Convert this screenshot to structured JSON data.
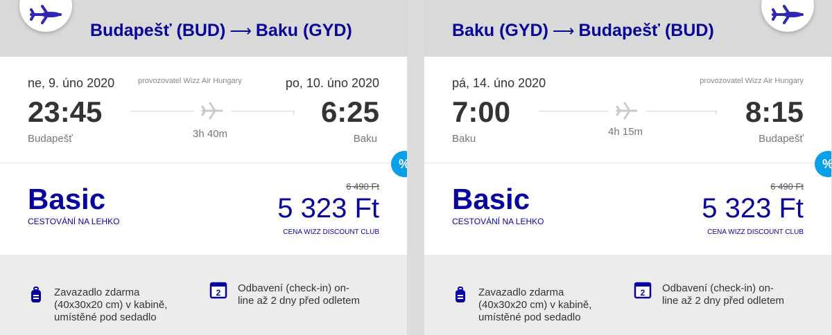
{
  "cards": [
    {
      "from": "Budapešť (BUD)",
      "arrow": "⟶",
      "to": "Baku  (GYD)",
      "dep_date": "ne, 9. úno 2020",
      "operator": "provozovatel Wizz Air Hungary",
      "arr_date": "po, 10. úno 2020",
      "dep_time": "23:45",
      "arr_time": "6:25",
      "duration": "3h 40m",
      "dep_city": "Budapešť",
      "arr_city": "Baku",
      "fare_name": "Basic",
      "fare_sub": "CESTOVÁNÍ NA LEHKO",
      "old_price": "6 490 Ft",
      "new_price": "5 323 Ft",
      "club_label": "CENA WIZZ DISCOUNT CLUB",
      "discount_badge": "%",
      "benefit_bag": "Zavazadlo zdarma\n(40x30x20 cm) v kabině,\numístěné pod sedadlo",
      "benefit_checkin": "Odbavení (check-in) on-\nline až 2 dny před odletem",
      "checkin_icon_num": "2"
    },
    {
      "from": "Baku  (GYD)",
      "arrow": "⟶",
      "to": "Budapešť (BUD)",
      "dep_date": "pá, 14. úno 2020",
      "operator": "provozovatel Wizz Air Hungary",
      "arr_date": "",
      "dep_time": "7:00",
      "arr_time": "8:15",
      "duration": "4h 15m",
      "dep_city": "Baku",
      "arr_city": "Budapešť",
      "fare_name": "Basic",
      "fare_sub": "CESTOVÁNÍ NA LEHKO",
      "old_price": "6 490 Ft",
      "new_price": "5 323 Ft",
      "club_label": "CENA WIZZ DISCOUNT CLUB",
      "discount_badge": "%",
      "benefit_bag": "Zavazadlo zdarma\n(40x30x20 cm) v kabině,\numístěné pod sedadlo",
      "benefit_checkin": "Odbavení (check-in) on-\nline až 2 dny před odletem",
      "checkin_icon_num": "2"
    }
  ],
  "colors": {
    "brand": "#06049a",
    "discount": "#0aa0e8",
    "plane": "#2d29b4"
  }
}
